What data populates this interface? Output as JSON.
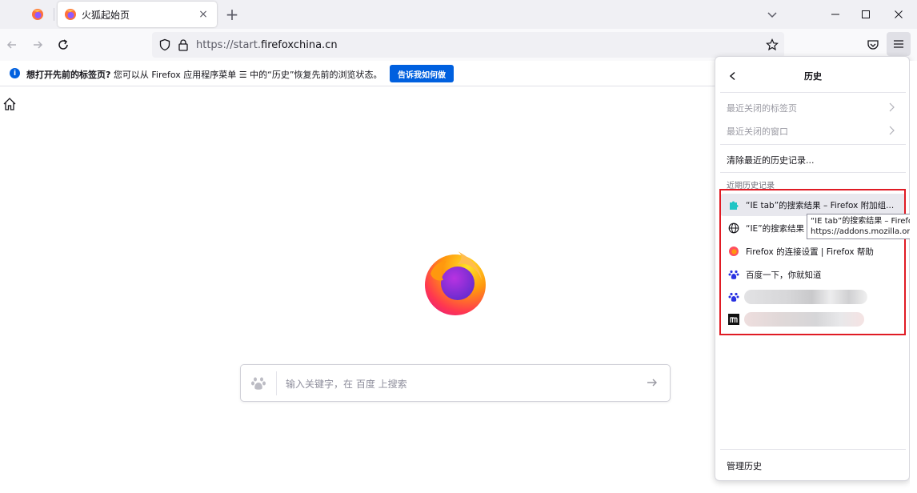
{
  "tabs": {
    "active_title": "火狐起始页",
    "close_glyph": "×",
    "new_tab_glyph": "+"
  },
  "window": {
    "minimize_glyph": "—",
    "maximize_glyph": "☐",
    "close_glyph": "✕"
  },
  "navbar": {
    "url_prefix": "https://start.",
    "url_host": "firefoxchina.cn"
  },
  "notification": {
    "icon_glyph": "i",
    "bold_text": "想打开先前的标签页?",
    "text": " 您可以从 Firefox 应用程序菜单 ☰ 中的“历史”恢复先前的浏览状态。",
    "button_label": "告诉我如何做"
  },
  "search": {
    "placeholder": "输入关键字，在 百度 上搜索"
  },
  "history_panel": {
    "title": "历史",
    "recently_closed_tabs": "最近关闭的标签页",
    "recently_closed_windows": "最近关闭的窗口",
    "clear_recent": "清除最近的历史记录...",
    "section_label": "近期历史记录",
    "items": [
      {
        "label": "“IE tab”的搜索结果 – Firefox 附加组...",
        "icon": "puzzle-icon"
      },
      {
        "label": "“IE”的搜索结果 – ",
        "icon": "globe-icon"
      },
      {
        "label": "Firefox 的连接设置 | Firefox 帮助",
        "icon": "firefox-icon"
      },
      {
        "label": "百度一下，你就知道",
        "icon": "baidu-icon"
      },
      {
        "label": "",
        "icon": "baidu-icon"
      },
      {
        "label": "",
        "icon": "m-icon"
      }
    ],
    "manage_label": "管理历史"
  },
  "tooltip": {
    "line1": "“IE tab”的搜索结果 – Firefox",
    "line2": "https://addons.mozilla.org"
  },
  "colors": {
    "accent": "#0060df",
    "highlight_box": "#e01b24"
  }
}
